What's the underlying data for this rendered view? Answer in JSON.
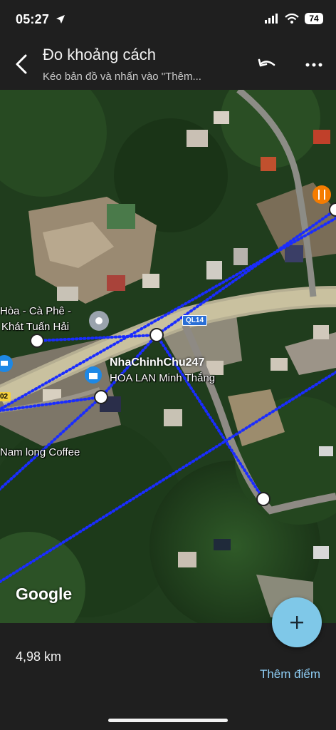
{
  "status_bar": {
    "time": "05:27",
    "battery": "74"
  },
  "header": {
    "title": "Đo khoảng cách",
    "subtitle": "Kéo bản đồ và nhấn vào \"Thêm..."
  },
  "map": {
    "labels": {
      "cafe_line1": "Hòa - Cà Phê -",
      "cafe_line2": "Khát Tuấn Hải",
      "hoa_lan": "HOA LAN Minh Thắng",
      "nam_long": "Nam long Coffee",
      "road_ql14": "QL14",
      "road_left": "02"
    },
    "watermark": "NhaChinhChu247",
    "google": "Google"
  },
  "bottom": {
    "distance": "4,98 km",
    "add_point": "Thêm điểm"
  },
  "colors": {
    "accent": "#8ecdf4",
    "measure_line": "#1a2cff",
    "fab": "#7fc8e8"
  }
}
